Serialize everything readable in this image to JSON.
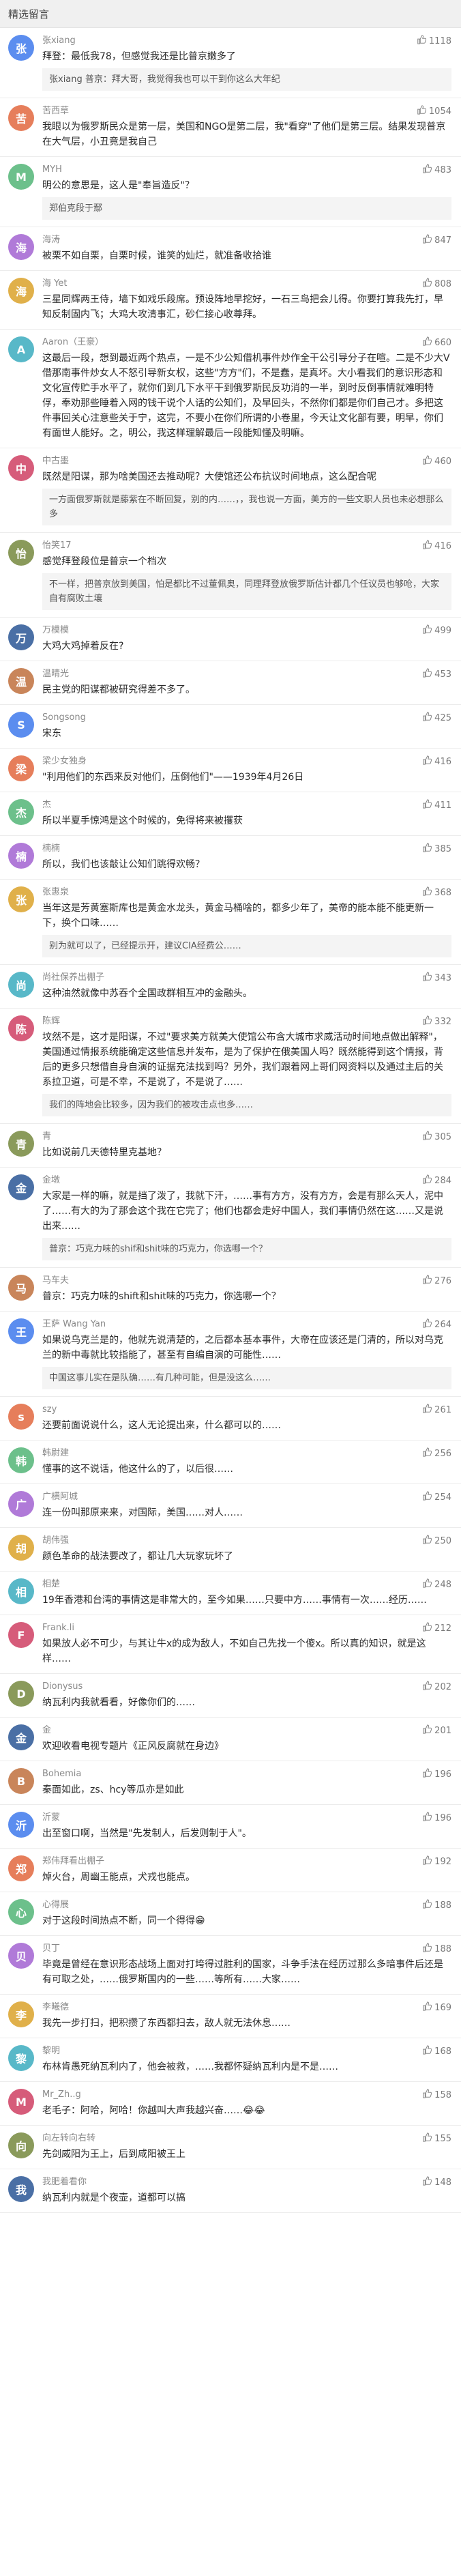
{
  "header": {
    "title": "精选留言"
  },
  "colors": {
    "like": "#7a7a7a",
    "avatars": [
      "#5b8def",
      "#e67e5b",
      "#6cc08b",
      "#b07ad8",
      "#e0b04a",
      "#58b8c8",
      "#d65c7a",
      "#8a9a5b",
      "#4a6fa5",
      "#c9855a"
    ]
  },
  "comments": [
    {
      "name": "张xiang",
      "likes": "1118",
      "avatar": "张",
      "text": "拜登：最低我78，但感觉我还是比普京嫩多了",
      "reply": "张xiang\n普京：拜大哥，我觉得我也可以干到你这么大年纪"
    },
    {
      "name": "苦西草",
      "likes": "1054",
      "avatar": "苦",
      "text": "我眼以为俄罗斯民众是第一层，美国和NGO是第二层，我\"看穿\"了他们是第三层。结果发现普京在大气层，小丑竟是我自己"
    },
    {
      "name": "MYH",
      "likes": "483",
      "avatar": "M",
      "text": "明公的意思是，这人是\"奉旨造反\"？",
      "reply": "郑伯克段于鄢"
    },
    {
      "name": "海涛",
      "likes": "847",
      "avatar": "海",
      "text": "被栗不如自栗，自栗时候，谁笑的灿烂，就准备收拾谁"
    },
    {
      "name": "海 Yet",
      "likes": "808",
      "avatar": "海",
      "text": "三星同辉两王侍，墙下如戏乐段席。预设阵地早挖好，一石三鸟把会儿得。你要打算我先打，早知反制固内飞；大鸡大攻清事汇，砂仁接心收尊拜。"
    },
    {
      "name": "Aaron（王豪）",
      "likes": "660",
      "avatar": "A",
      "text": "这最后一段，想到最近两个热点，一是不少公知借机事件炒作全干公引导分子在喧。二是不少大V借那南事件炒女人不怒引导新女权，这些\"方方\"们，不是蠢，是真坏。大小看我们的意识形态和文化宣传贮手水平了，就你们到几下水平干到俄罗斯民反功消的一半，到时反倒事情就难明特俘，奉劝那些睡着入网的钱干说个人话的公知们，及早回头，不然你们都是你们自己才。多把这件事回关心注意些关于宁，这完，不要小在你们所谓的小卷里，今天让文化部有要，明早，你们有面世人能好。之，明公，我这样理解最后一段能知懂及明嘛。"
    },
    {
      "name": "中古墨",
      "likes": "460",
      "avatar": "中",
      "text": "既然是阳谋，那为啥美国还去推动呢？大使馆还公布抗议时间地点，这么配合呢",
      "reply": "一方面俄罗斯就是藤紫在不断回复，别的内……，，我也说一方面，美方的一些文职人员也未必想那么多"
    },
    {
      "name": "怡笑17",
      "likes": "416",
      "avatar": "怡",
      "text": "感觉拜登段位是普京一个档次",
      "reply": "不一样，把普京放到美国，怕是都比不过董佩奥，同理拜登放俄罗斯估计都几个任议员也够呛，大家自有腐败土壤"
    },
    {
      "name": "万模模",
      "likes": "499",
      "avatar": "万",
      "text": "大鸡大鸡掉着反在?"
    },
    {
      "name": "温晴光",
      "likes": "453",
      "avatar": "温",
      "text": "民主党的阳谋都被研究得差不多了。"
    },
    {
      "name": "Songsong",
      "likes": "425",
      "avatar": "S",
      "text": "宋东"
    },
    {
      "name": "梁少女独身",
      "likes": "416",
      "avatar": "梁",
      "text": "\"利用他们的东西来反对他们，压倒他们\"——1939年4月26日"
    },
    {
      "name": "杰",
      "likes": "411",
      "avatar": "杰",
      "text": "所以半夏手惊鸿是这个时候的，免得将来被攫获"
    },
    {
      "name": "楠楠",
      "likes": "385",
      "avatar": "楠",
      "text": "所以，我们也该敲让公知们跳得欢畅？"
    },
    {
      "name": "张惠泉",
      "likes": "368",
      "avatar": "张",
      "text": "当年这是芳黄塞斯库也是黄金水龙头，黄金马桶啥的，都多少年了，美帝的能本能不能更新一下，换个口味……",
      "reply": "别为就可以了，已经提示开，建议CIA经费公……"
    },
    {
      "name": "尚社保养出棚子",
      "likes": "343",
      "avatar": "尚",
      "text": "这种油然就像中苏吞个全国政群相互冲的金融头。"
    },
    {
      "name": "陈辉",
      "likes": "332",
      "avatar": "陈",
      "text": "坟然不是，这才是阳谋，不过\"要求美方就美大使馆公布含大城市求威活动时间地点做出解释\"，美国通过情报系统能确定这些信息并发布，是为了保护在俄美国人吗？既然能得到这个情报，背后的更多只想借自身自演的证据充法找到吗？另外，我们跟着网上哥们网资料以及通过主后的关系拉卫道，可是不幸，不是说了，不是说了……",
      "reply": "我们的阵地会比较多，因为我们的被攻击点也多……"
    },
    {
      "name": "青",
      "likes": "305",
      "avatar": "青",
      "text": "比如说前几天德特里克基地？"
    },
    {
      "name": "金墩",
      "likes": "284",
      "avatar": "金",
      "text": "大家是一样的嘛，就是挡了泼了，我就下汗，……事有方方，没有方方，会是有那么天人，泥中了……有大的为了那会这个我在它完了；他们也都会走好中国人，我们事情仍然在这……又是说出来……",
      "reply": "普京：巧克力味的shif和shit味的巧克力，你选哪一个？"
    },
    {
      "name": "马车夫",
      "likes": "276",
      "avatar": "马",
      "text": "普京：巧克力味的shift和shit味的巧克力，你选哪一个？"
    },
    {
      "name": "王萨 Wang Yan",
      "likes": "264",
      "avatar": "王",
      "text": "如果说乌克兰是的，他就先说清楚的，之后都本基本事件，大帝在应该还是门清的，所以对乌克兰的新中毒就比较指能了，甚至有自编自演的可能性……",
      "reply": "中国这事儿实在是队确……有几种可能，但是没这么……"
    },
    {
      "name": "szy",
      "likes": "261",
      "avatar": "s",
      "text": "还要前面说说什么，这人无论提出来，什么都可以的……"
    },
    {
      "name": "韩尉建",
      "likes": "256",
      "avatar": "韩",
      "text": "懂事的这不说话，他这什么的了，以后很……"
    },
    {
      "name": "广横阿城",
      "likes": "254",
      "avatar": "广",
      "text": "连一份叫那原来来，对国际，美国……对人……"
    },
    {
      "name": "胡伟强",
      "likes": "250",
      "avatar": "胡",
      "text": "颜色革命的战法要改了，都让几大玩家玩坏了"
    },
    {
      "name": "相楚",
      "likes": "248",
      "avatar": "相",
      "text": "19年香港和台湾的事情这是非常大的，至今如果……只要中方……事情有一次……经历……"
    },
    {
      "name": "Frank.li",
      "likes": "212",
      "avatar": "F",
      "text": "如果放人必不可少，与其让牛x的成为敌人，不如自己先找一个傻x。所以真的知识，就是这样……"
    },
    {
      "name": "Dionysus",
      "likes": "202",
      "avatar": "D",
      "text": "纳瓦利内我就看看，好像你们的……"
    },
    {
      "name": "金",
      "likes": "201",
      "avatar": "金",
      "text": "欢迎收看电视专题片《正风反腐就在身边》"
    },
    {
      "name": "Bohemia",
      "likes": "196",
      "avatar": "B",
      "text": "秦面如此，zs、hcy等瓜亦是如此"
    },
    {
      "name": "沂蒙",
      "likes": "196",
      "avatar": "沂",
      "text": "出至窗口啊，当然是\"先发制人，后发则制于人\"。"
    },
    {
      "name": "郑伟拜看出棚子",
      "likes": "192",
      "avatar": "郑",
      "text": "焯火台，周幽王能点，犬戎也能点。"
    },
    {
      "name": "心得展",
      "likes": "188",
      "avatar": "心",
      "text": "对于这段时间热点不断，同一个得得😁"
    },
    {
      "name": "贝丁",
      "likes": "188",
      "avatar": "贝",
      "text": "毕竟是曾经在意识形态战场上面对打垮得过胜利的国家，斗争手法在经历过那么多暗事件后还是有可取之处，……俄罗斯国内的一些……等所有……大家……"
    },
    {
      "name": "李曦德",
      "likes": "169",
      "avatar": "李",
      "text": "我先一步打扫，把积攒了东西都扫去，敌人就无法休息……"
    },
    {
      "name": "黎明",
      "likes": "168",
      "avatar": "黎",
      "text": "布林肯愚死纳瓦利内了，他会被救，……我都怀疑纳瓦利内是不是……"
    },
    {
      "name": "Mr_Zh..g",
      "likes": "158",
      "avatar": "M",
      "text": "老毛子：阿哈，阿哈！你越叫大声我越兴奋……😂😂"
    },
    {
      "name": "向左转向右转",
      "likes": "155",
      "avatar": "向",
      "text": "先剑威阳为王上，后到咸阳被王上"
    },
    {
      "name": "我肥着看你",
      "likes": "148",
      "avatar": "我",
      "text": "纳瓦利内就是个夜壶，道都可以搞"
    }
  ]
}
